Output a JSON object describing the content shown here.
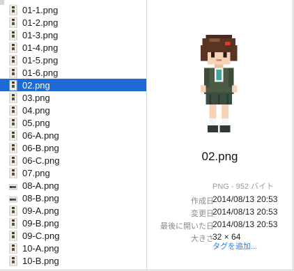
{
  "files": [
    {
      "name": "01-1.png",
      "icon": "character-thumbnail-icon"
    },
    {
      "name": "01-2.png",
      "icon": "character-thumbnail-icon"
    },
    {
      "name": "01-3.png",
      "icon": "character-thumbnail-icon"
    },
    {
      "name": "01-4.png",
      "icon": "character-thumbnail-icon"
    },
    {
      "name": "01-5.png",
      "icon": "character-thumbnail-icon"
    },
    {
      "name": "01-6.png",
      "icon": "character-thumbnail-icon"
    },
    {
      "name": "02.png",
      "icon": "character-thumbnail-icon",
      "selected": true
    },
    {
      "name": "03.png",
      "icon": "character-thumbnail-icon"
    },
    {
      "name": "04.png",
      "icon": "character-thumbnail-icon"
    },
    {
      "name": "05.png",
      "icon": "character-thumbnail-icon"
    },
    {
      "name": "06-A.png",
      "icon": "character-thumbnail-icon"
    },
    {
      "name": "06-B.png",
      "icon": "character-thumbnail-icon"
    },
    {
      "name": "06-C.png",
      "icon": "character-thumbnail-icon"
    },
    {
      "name": "07.png",
      "icon": "character-thumbnail-icon"
    },
    {
      "name": "08-A.png",
      "icon": "lying-character-thumbnail-icon"
    },
    {
      "name": "08-B.png",
      "icon": "lying-character-thumbnail-icon"
    },
    {
      "name": "09-A.png",
      "icon": "character-thumbnail-icon"
    },
    {
      "name": "09-B.png",
      "icon": "character-thumbnail-icon"
    },
    {
      "name": "09-C.png",
      "icon": "character-thumbnail-icon"
    },
    {
      "name": "10-A.png",
      "icon": "character-thumbnail-icon"
    },
    {
      "name": "10-B.png",
      "icon": "character-thumbnail-icon"
    }
  ],
  "preview": {
    "filename": "02.png",
    "kind": "PNG - 952 バイト",
    "info": [
      {
        "label": "作成日",
        "value": "2014/08/13 20:53"
      },
      {
        "label": "変更日",
        "value": "2014/08/13 20:53"
      },
      {
        "label": "最後に開いた日",
        "value": "2014/08/13 20:53"
      },
      {
        "label": "大きさ",
        "value": "32 × 64"
      }
    ],
    "add_tags": "タグを追加..."
  },
  "colors": {
    "selection": "#1d6ad6",
    "link": "#2f7be6",
    "label_gray": "#8a8a8a"
  }
}
